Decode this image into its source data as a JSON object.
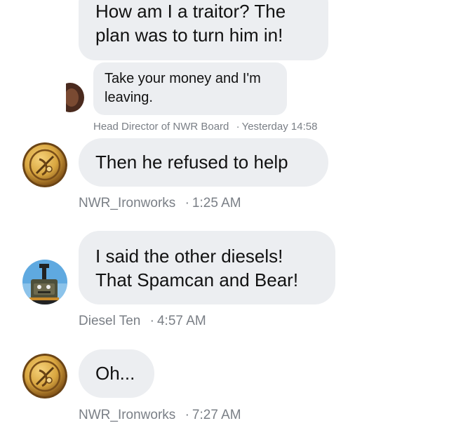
{
  "chat": {
    "messages": [
      {
        "text": "How am I a traitor? The plan was to turn him in!",
        "author": "",
        "time": ""
      },
      {
        "text": "Take your money and I'm leaving.",
        "author": "Head Director of NWR Board",
        "time": "Yesterday 14:58",
        "quoted": true
      },
      {
        "text": "Then he refused to help",
        "author": "NWR_Ironworks",
        "time": "1:25 AM"
      },
      {
        "text": "I said the other diesels! That Spamcan and Bear!",
        "author": "Diesel Ten",
        "time": "4:57 AM"
      },
      {
        "text": "Oh...",
        "author": "NWR_Ironworks",
        "time": "7:27 AM"
      }
    ],
    "separator": "·"
  },
  "colors": {
    "bubble": "#ECEEF1",
    "meta_text": "#7a7f86",
    "ironworks_gold": "#D9A640"
  },
  "icons": {
    "ironworks_avatar": "gold-coin-emblem",
    "diesel_avatar": "diesel-engine-portrait",
    "quoted_avatar": "partial-avatar"
  }
}
